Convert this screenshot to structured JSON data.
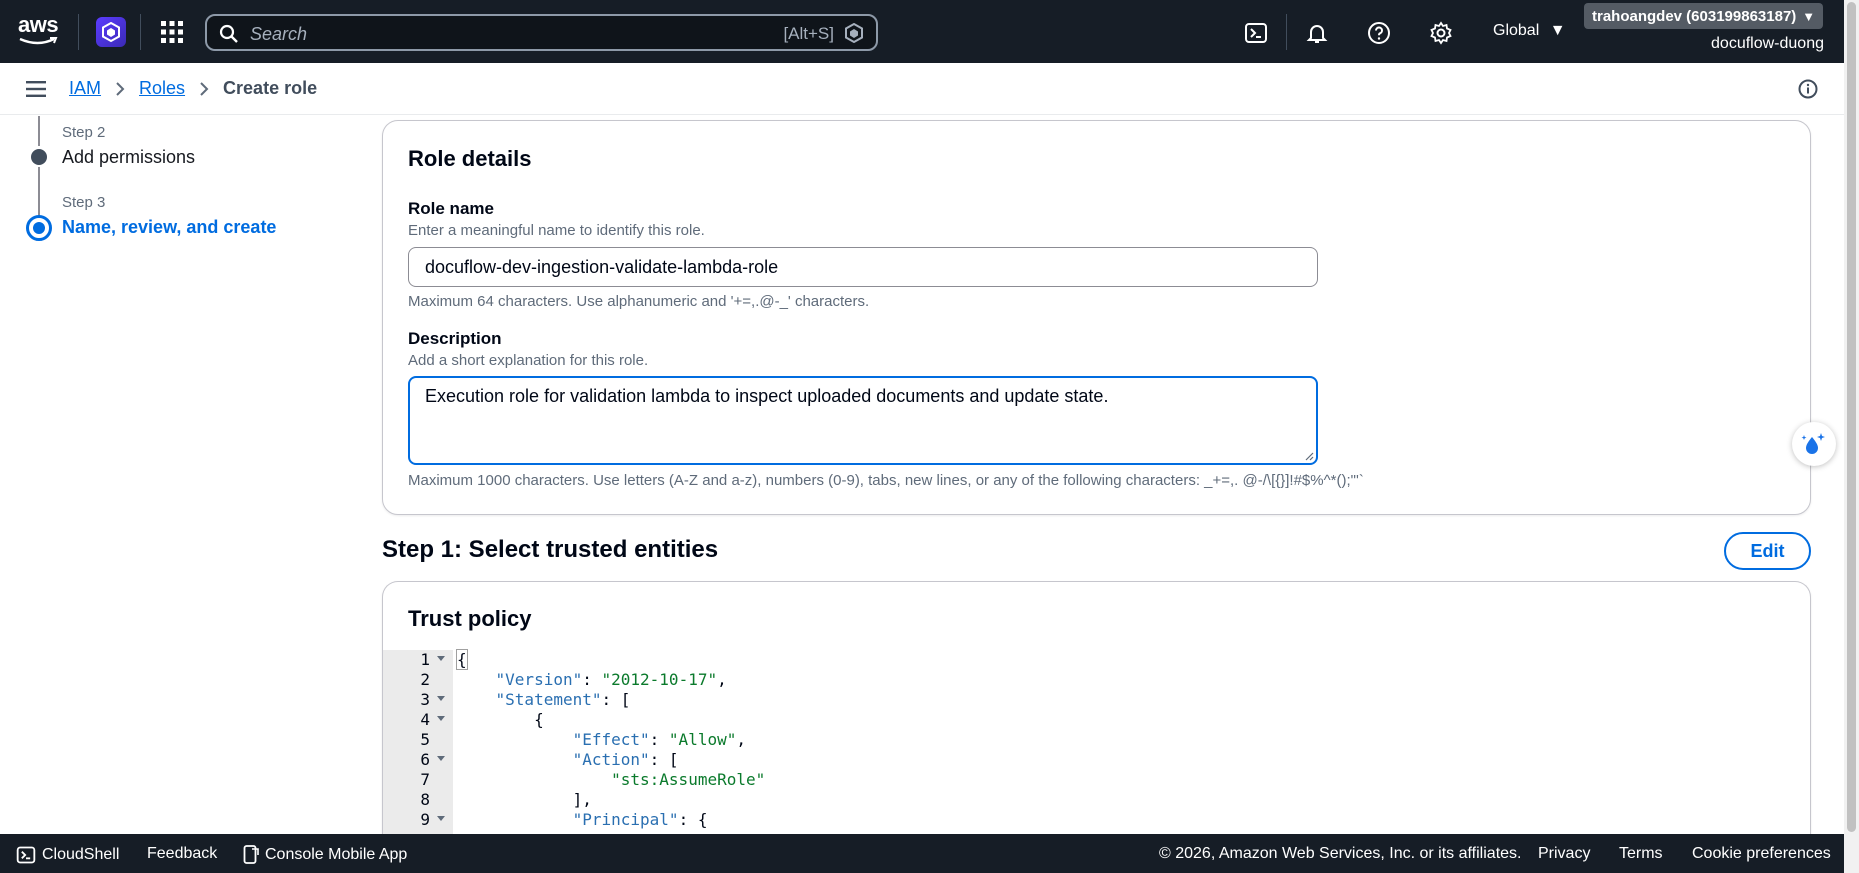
{
  "topnav": {
    "logo_text": "aws",
    "search_placeholder": "Search",
    "search_shortcut": "[Alt+S]",
    "region_label": "Global",
    "account_label": "trahoangdev (603199863187)",
    "account_sub": "docuflow-duong"
  },
  "breadcrumb": {
    "items": [
      "IAM",
      "Roles"
    ],
    "current": "Create role"
  },
  "wizard": {
    "steps": [
      {
        "label": "Step 2",
        "title": "Add permissions"
      },
      {
        "label": "Step 3",
        "title": "Name, review, and create"
      }
    ]
  },
  "role_details": {
    "title": "Role details",
    "role_name_label": "Role name",
    "role_name_desc": "Enter a meaningful name to identify this role.",
    "role_name_value": "docuflow-dev-ingestion-validate-lambda-role",
    "role_name_hint": "Maximum 64 characters. Use alphanumeric and '+=,.@-_' characters.",
    "description_label": "Description",
    "description_desc": "Add a short explanation for this role.",
    "description_value": "Execution role for validation lambda to inspect uploaded documents and update state.",
    "description_hint": "Maximum 1000 characters. Use letters (A-Z and a-z), numbers (0-9), tabs, new lines, or any of the following characters: _+=,. @-/\\[{}]!#$%^*();\"'`"
  },
  "step1": {
    "title": "Step 1: Select trusted entities",
    "edit_label": "Edit",
    "trust_policy_title": "Trust policy"
  },
  "code_lines": [
    {
      "n": "1",
      "fold": true,
      "indent": "",
      "key": "",
      "sep": "",
      "val": "",
      "tail": "{"
    },
    {
      "n": "2",
      "fold": false,
      "indent": "    ",
      "key": "\"Version\"",
      "sep": ": ",
      "val": "\"2012-10-17\"",
      "tail": ","
    },
    {
      "n": "3",
      "fold": true,
      "indent": "    ",
      "key": "\"Statement\"",
      "sep": ": ",
      "val": "",
      "tail": "["
    },
    {
      "n": "4",
      "fold": true,
      "indent": "        ",
      "key": "",
      "sep": "",
      "val": "",
      "tail": "{"
    },
    {
      "n": "5",
      "fold": false,
      "indent": "            ",
      "key": "\"Effect\"",
      "sep": ": ",
      "val": "\"Allow\"",
      "tail": ","
    },
    {
      "n": "6",
      "fold": true,
      "indent": "            ",
      "key": "\"Action\"",
      "sep": ": ",
      "val": "",
      "tail": "["
    },
    {
      "n": "7",
      "fold": false,
      "indent": "                ",
      "key": "",
      "sep": "",
      "val": "\"sts:AssumeRole\"",
      "tail": ""
    },
    {
      "n": "8",
      "fold": false,
      "indent": "            ",
      "key": "",
      "sep": "",
      "val": "",
      "tail": "],"
    },
    {
      "n": "9",
      "fold": true,
      "indent": "            ",
      "key": "\"Principal\"",
      "sep": ": ",
      "val": "",
      "tail": "{"
    }
  ],
  "footer": {
    "cloudshell": "CloudShell",
    "feedback": "Feedback",
    "mobile_app": "Console Mobile App",
    "copyright": "© 2026, Amazon Web Services, Inc. or its affiliates.",
    "privacy": "Privacy",
    "terms": "Terms",
    "cookies": "Cookie preferences"
  },
  "colors": {
    "nav_bg": "#161d26",
    "link_blue": "#006ce0",
    "json_key": "#2a6fb1",
    "json_string": "#0b7a2c"
  }
}
